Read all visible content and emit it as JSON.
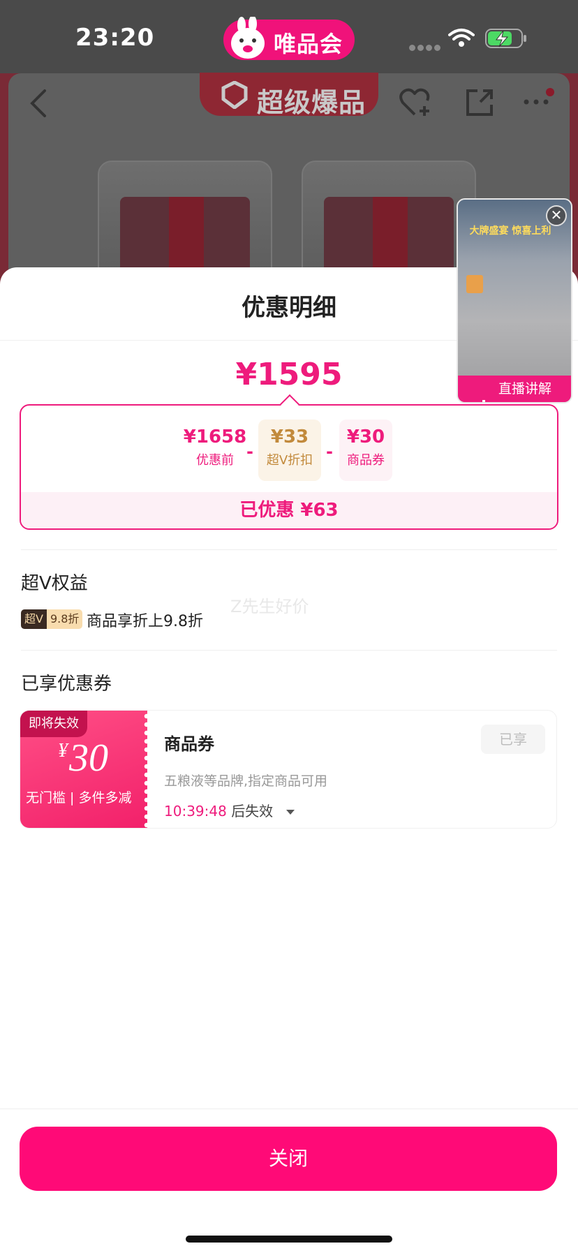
{
  "status_bar": {
    "time": "23:20",
    "app_brand": "唯品会"
  },
  "product_page": {
    "banner_text": "超级爆品"
  },
  "live_video": {
    "label": "直播讲解",
    "close_symbol": "✕",
    "overlay_title": "大牌盛宴 惊喜上利"
  },
  "sheet": {
    "title": "优惠明细",
    "total_price": "¥1595",
    "breakdown": {
      "original": {
        "amount": "¥1658",
        "label": "优惠前"
      },
      "operator1": "-",
      "discount": {
        "amount": "¥33",
        "label": "超V折扣"
      },
      "operator2": "-",
      "coupon": {
        "amount": "¥30",
        "label": "商品券"
      },
      "saved": "已优惠 ¥63"
    },
    "super_v": {
      "title": "超V权益",
      "badge_left": "超V",
      "badge_right": "9.8折",
      "desc": "商品享折上9.8折",
      "watermark": "Z先生好价"
    },
    "coupons_section": {
      "title": "已享优惠券",
      "coupon": {
        "tag": "即将失效",
        "currency": "¥",
        "amount": "30",
        "condition": "无门槛 | 多件多减",
        "name": "商品券",
        "status_button": "已享",
        "scope": "五粮液等品牌,指定商品可用",
        "countdown": "10:39:48",
        "expire_suffix": "后失效"
      }
    },
    "close_label": "关闭"
  },
  "colors": {
    "accent": "#ee1b7c",
    "gold": "#c28a3c",
    "close_button": "#ff0a77"
  }
}
